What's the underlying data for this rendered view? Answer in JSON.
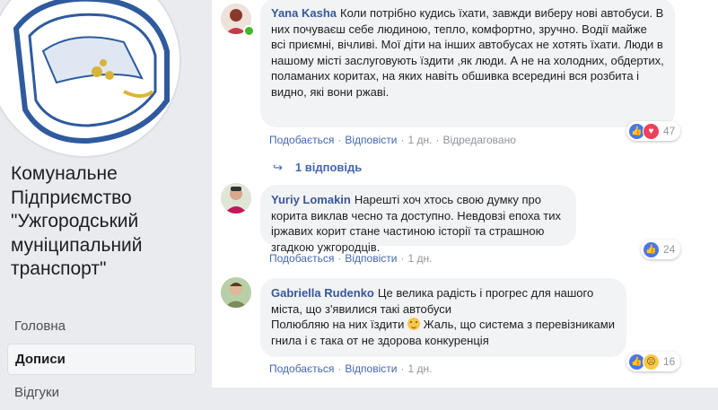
{
  "page": {
    "name": "Комунальне Підприємство \"Ужгородський муніципальний транспорт\""
  },
  "nav": {
    "items": [
      {
        "label": "Головна"
      },
      {
        "label": "Дописи"
      },
      {
        "label": "Відгуки"
      }
    ]
  },
  "comments": [
    {
      "author": "Yana Kasha",
      "text": "Коли потрібно кудись їхати, завжди виберу нові автобуси. В них почуваєш себе людиною, тепло, комфортно, зручно. Водії майже всі приємні, вічливі. Мої діти на інших автобусах не хотять їхати. Люди в нашому місті заслуговують їздити ,як люди. А не на холодних, обдертих, поламаних коритах, на яких навіть обшивка всередині вся розбита і видно, які вони ржаві.",
      "like": "Подобається",
      "reply": "Відповісти",
      "time": "1 дн.",
      "edited": "Відредаговано",
      "reaction_count": "47",
      "reactions": [
        "like-icon",
        "love-icon"
      ],
      "replies_label": "1 відповідь"
    },
    {
      "author": "Yuriy Lomakin",
      "text": "Нарешті хоч хтось свою думку про корита виклав чесно та доступно. Невдовзі епоха тих іржавих корит стане частиною історії та страшною згадкою ужгородців.",
      "like": "Подобається",
      "reply": "Відповісти",
      "time": "1 дн.",
      "reaction_count": "24",
      "reactions": [
        "like-icon"
      ]
    },
    {
      "author": "Gabriella Rudenko",
      "text_line1": "Це велика радість і прогрес для нашого міста, що з'явилися такі автобуси",
      "text_line2a": "Полюбляю на них їздити",
      "text_line2b": "Жаль, що система з перевізниками гнила і є така от не здорова конкуренція",
      "like": "Подобається",
      "reply": "Відповісти",
      "time": "1 дн.",
      "reaction_count": "16",
      "reactions": [
        "like-icon",
        "sad-icon"
      ]
    }
  ],
  "colors": {
    "link": "#385898",
    "accent": "#4267b2",
    "bubble": "#f2f3f5",
    "logo_blue": "#2f5a9e",
    "logo_gold": "#d9b43a"
  }
}
